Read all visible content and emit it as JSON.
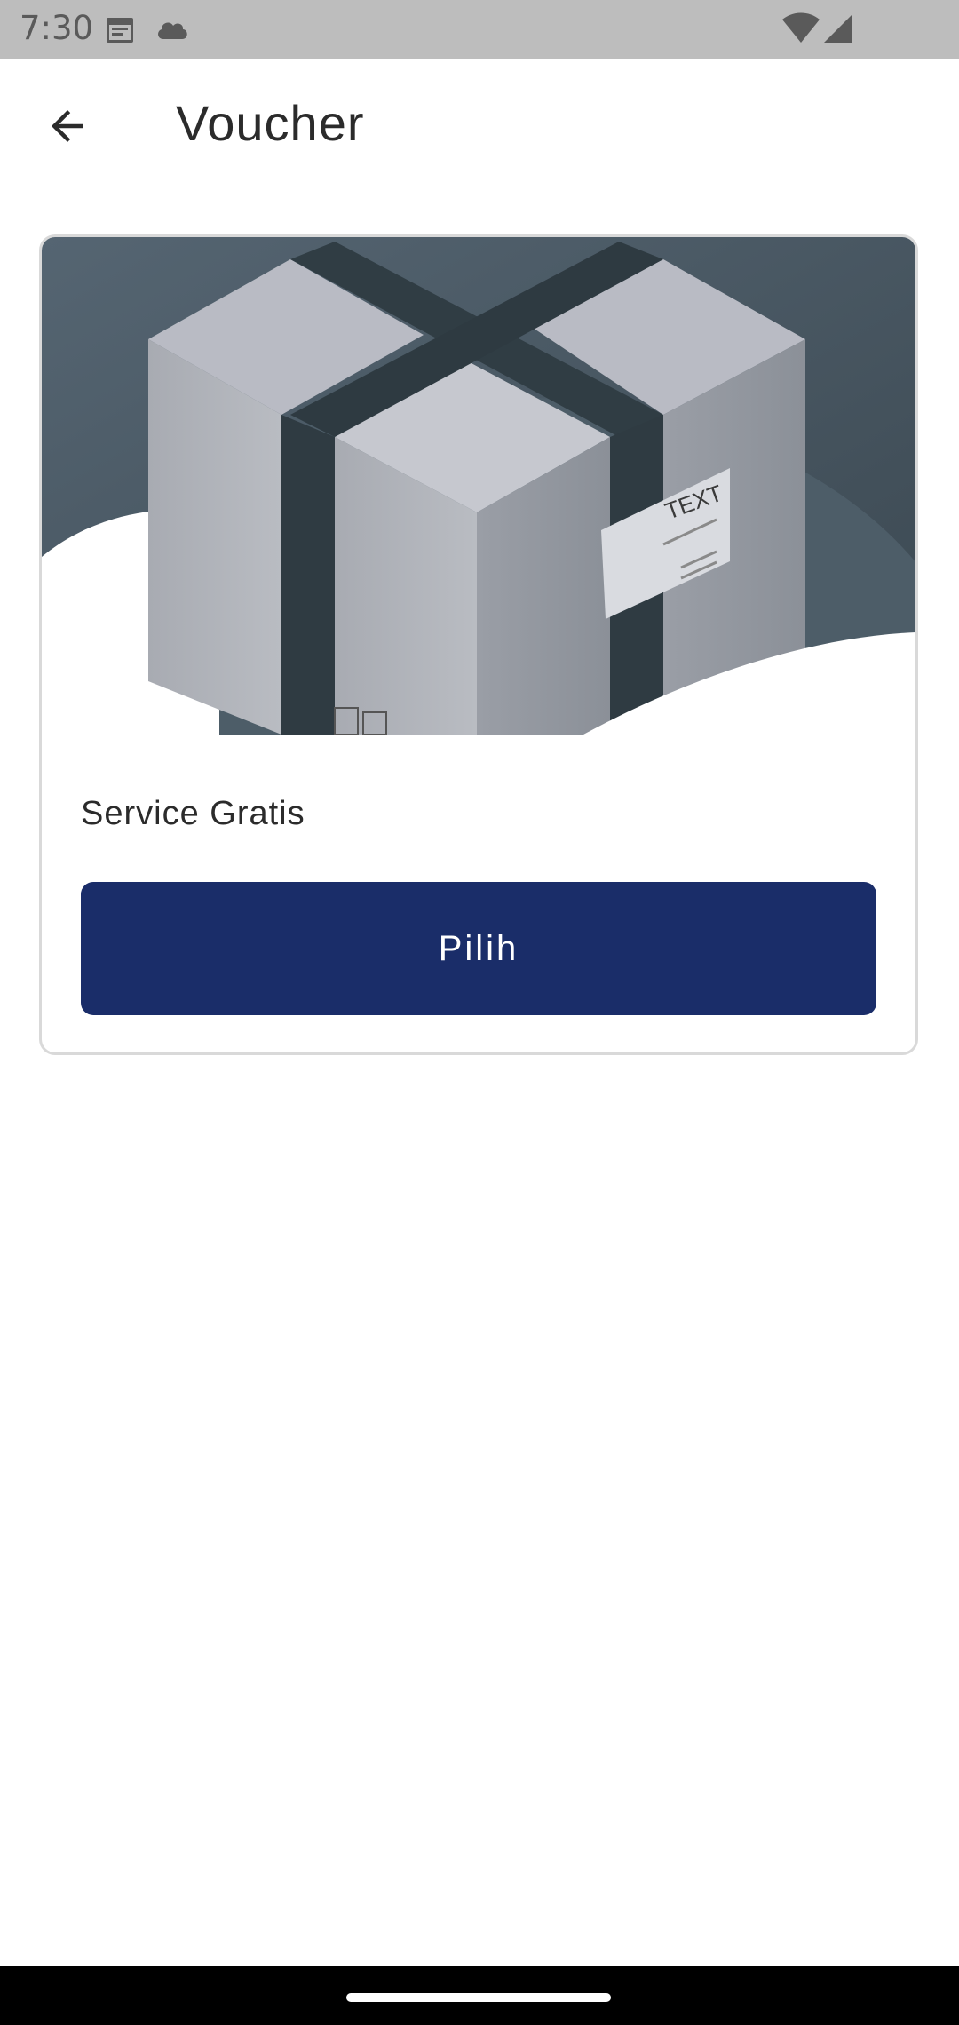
{
  "status_bar": {
    "time": "7:30",
    "icons": [
      "calendar-icon",
      "cloud-icon",
      "wifi-icon",
      "signal-icon"
    ]
  },
  "app_bar": {
    "back_icon": "arrow-back-icon",
    "title": "Voucher"
  },
  "vouchers": [
    {
      "image": "package-box-image",
      "image_text": "TEXT",
      "label": "Service Gratis",
      "button_label": "Pilih"
    }
  ],
  "colors": {
    "primary": "#1a2d69",
    "status_bar": "#bdbdbd",
    "card_border": "#d9d9d9"
  }
}
